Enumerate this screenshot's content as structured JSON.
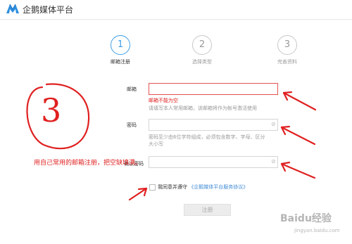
{
  "header": {
    "brand_name": "企鹅媒体平台"
  },
  "steps": [
    {
      "number": "1",
      "label": "邮箱注册",
      "active": true
    },
    {
      "number": "2",
      "label": "选择类型",
      "active": false
    },
    {
      "number": "3",
      "label": "完善资料",
      "active": false
    }
  ],
  "form": {
    "email": {
      "label": "邮箱",
      "value": "",
      "error": "邮箱不能为空",
      "hint": "请填写本人常用邮箱，该邮箱将作为帐号激活使用"
    },
    "password": {
      "label": "密码",
      "value": "",
      "hint_line1": "密码至少由6位字符组成，必须包含数字、字母、区分",
      "hint_line2": "大小写"
    },
    "confirm": {
      "label": "确认密码",
      "value": ""
    },
    "agree": {
      "text": "我同意并遵守",
      "link_text": "《企鹅媒体平台服务协议》",
      "checked": false
    },
    "submit_label": "注册"
  },
  "annotations": {
    "number": "3",
    "instruction": "用自己常用的邮箱注册，把空缺填满。"
  },
  "watermark": {
    "brand": "Baidu经验",
    "url": "jingyan.baidu.com"
  },
  "colors": {
    "accent": "#3e9ee8",
    "error": "#e02020",
    "annotation": "#e02020"
  }
}
